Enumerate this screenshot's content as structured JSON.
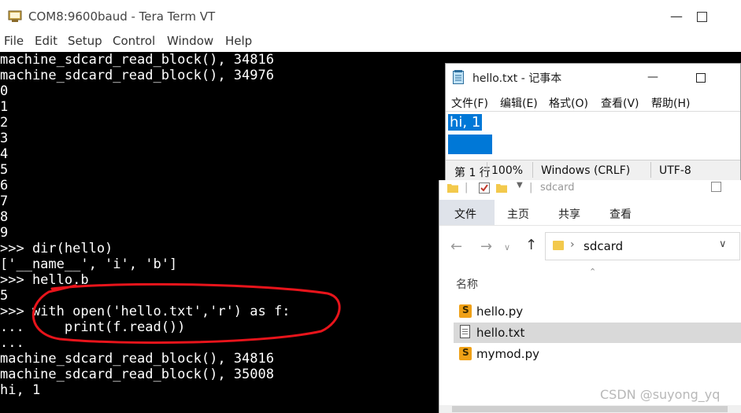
{
  "teraterm": {
    "title": "COM8:9600baud - Tera Term VT",
    "menu": [
      "File",
      "Edit",
      "Setup",
      "Control",
      "Window",
      "Help"
    ],
    "lines": [
      "machine_sdcard_read_block(), 34816",
      "machine_sdcard_read_block(), 34976",
      "0",
      "1",
      "2",
      "3",
      "4",
      "5",
      "6",
      "7",
      "8",
      "9",
      ">>> dir(hello)",
      "['__name__', 'i', 'b']",
      ">>> hello.b",
      "5",
      ">>> with open('hello.txt','r') as f:",
      "...     print(f.read())",
      "...",
      "machine_sdcard_read_block(), 34816",
      "machine_sdcard_read_block(), 35008",
      "hi, 1"
    ],
    "annotation_color": "#e8141b"
  },
  "notepad": {
    "title": "hello.txt - 记事本",
    "menu": [
      "文件(F)",
      "编辑(E)",
      "格式(O)",
      "查看(V)",
      "帮助(H)"
    ],
    "content": "hi, 1",
    "status": {
      "position": "第 1 行",
      "zoom": "100%",
      "line_ending": "Windows (CRLF)",
      "encoding": "UTF-8"
    },
    "selection_color": "#0078d7"
  },
  "explorer": {
    "qat_title": "sdcard",
    "tabs": [
      "文件",
      "主页",
      "共享",
      "查看"
    ],
    "address": "sdcard",
    "column_name": "名称",
    "files": [
      {
        "name": "hello.py",
        "type": "py",
        "selected": false
      },
      {
        "name": "hello.txt",
        "type": "txt",
        "selected": true
      },
      {
        "name": "mymod.py",
        "type": "py",
        "selected": false
      }
    ],
    "watermark": "CSDN @suyong_yq"
  }
}
